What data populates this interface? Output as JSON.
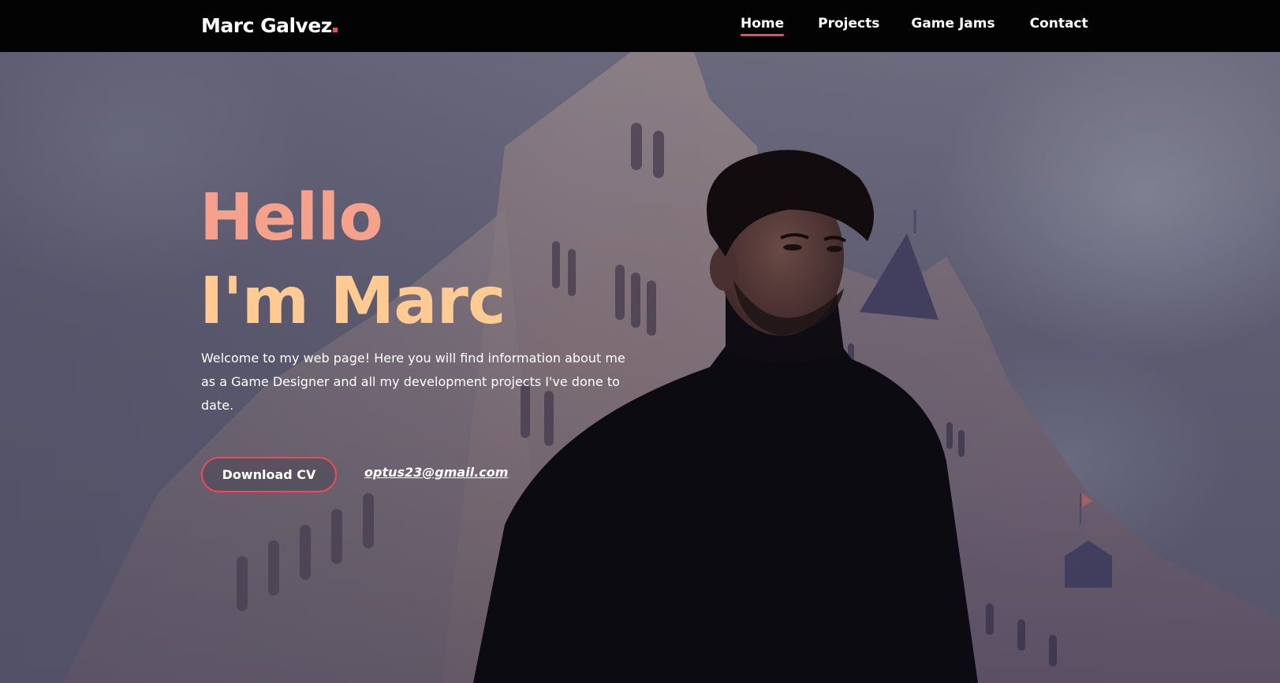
{
  "brand": {
    "name": "Marc Galvez",
    "accent_color": "#ef4a57"
  },
  "nav": {
    "items": [
      {
        "label": "Home",
        "active": true
      },
      {
        "label": "Projects",
        "active": false
      },
      {
        "label": "Game Jams",
        "active": false
      },
      {
        "label": "Contact",
        "active": false
      }
    ]
  },
  "hero": {
    "greeting": "Hello",
    "intro": "I'm Marc",
    "greeting_color": "#f6a18b",
    "intro_color": "#ffcb93",
    "description": "Welcome to my web page! Here you will find information about me as a Game Designer and all my development projects I've done to date.",
    "cv_button_label": "Download CV",
    "email": "optus23@gmail.com",
    "background_image": "portrait-photo-with-gothic-building"
  }
}
